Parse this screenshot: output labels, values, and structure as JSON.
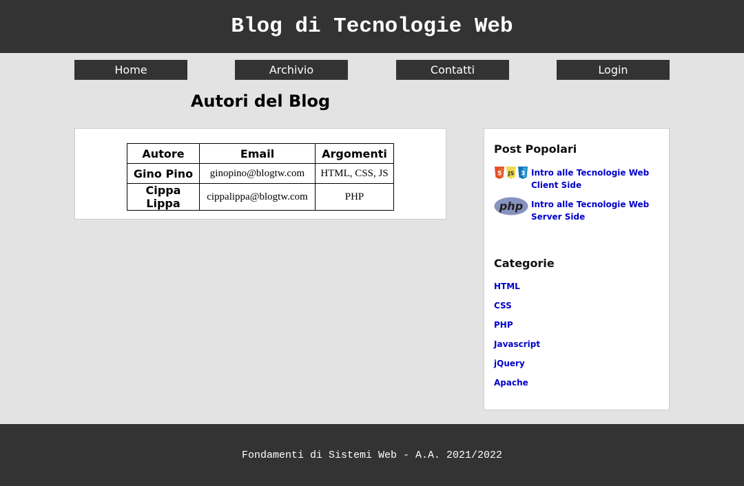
{
  "header": {
    "title": "Blog di Tecnologie Web"
  },
  "nav": {
    "items": [
      "Home",
      "Archivio",
      "Contatti",
      "Login"
    ]
  },
  "main": {
    "title": "Autori del Blog",
    "table": {
      "headers": [
        "Autore",
        "Email",
        "Argomenti"
      ],
      "rows": [
        [
          "Gino Pino",
          "ginopino@blogtw.com",
          "HTML, CSS, JS"
        ],
        [
          "Cippa Lippa",
          "cippalippa@blogtw.com",
          "PHP"
        ]
      ]
    }
  },
  "sidebar": {
    "popular_title": "Post Popolari",
    "posts": [
      {
        "title": "Intro alle Tecnologie Web Client Side",
        "icons": [
          "html5-icon",
          "js-icon",
          "css3-icon"
        ]
      },
      {
        "title": "Intro alle Tecnologie Web Server Side",
        "icons": [
          "php-logo-icon"
        ]
      }
    ],
    "categories_title": "Categorie",
    "categories": [
      "HTML",
      "CSS",
      "PHP",
      "Javascript",
      "jQuery",
      "Apache"
    ]
  },
  "footer": {
    "text": "Fondamenti di Sistemi Web - A.A. 2021/2022"
  },
  "colors": {
    "bar": "#333333",
    "background": "#e3e3e3",
    "link": "#0000cc",
    "php": "#8892bf"
  }
}
